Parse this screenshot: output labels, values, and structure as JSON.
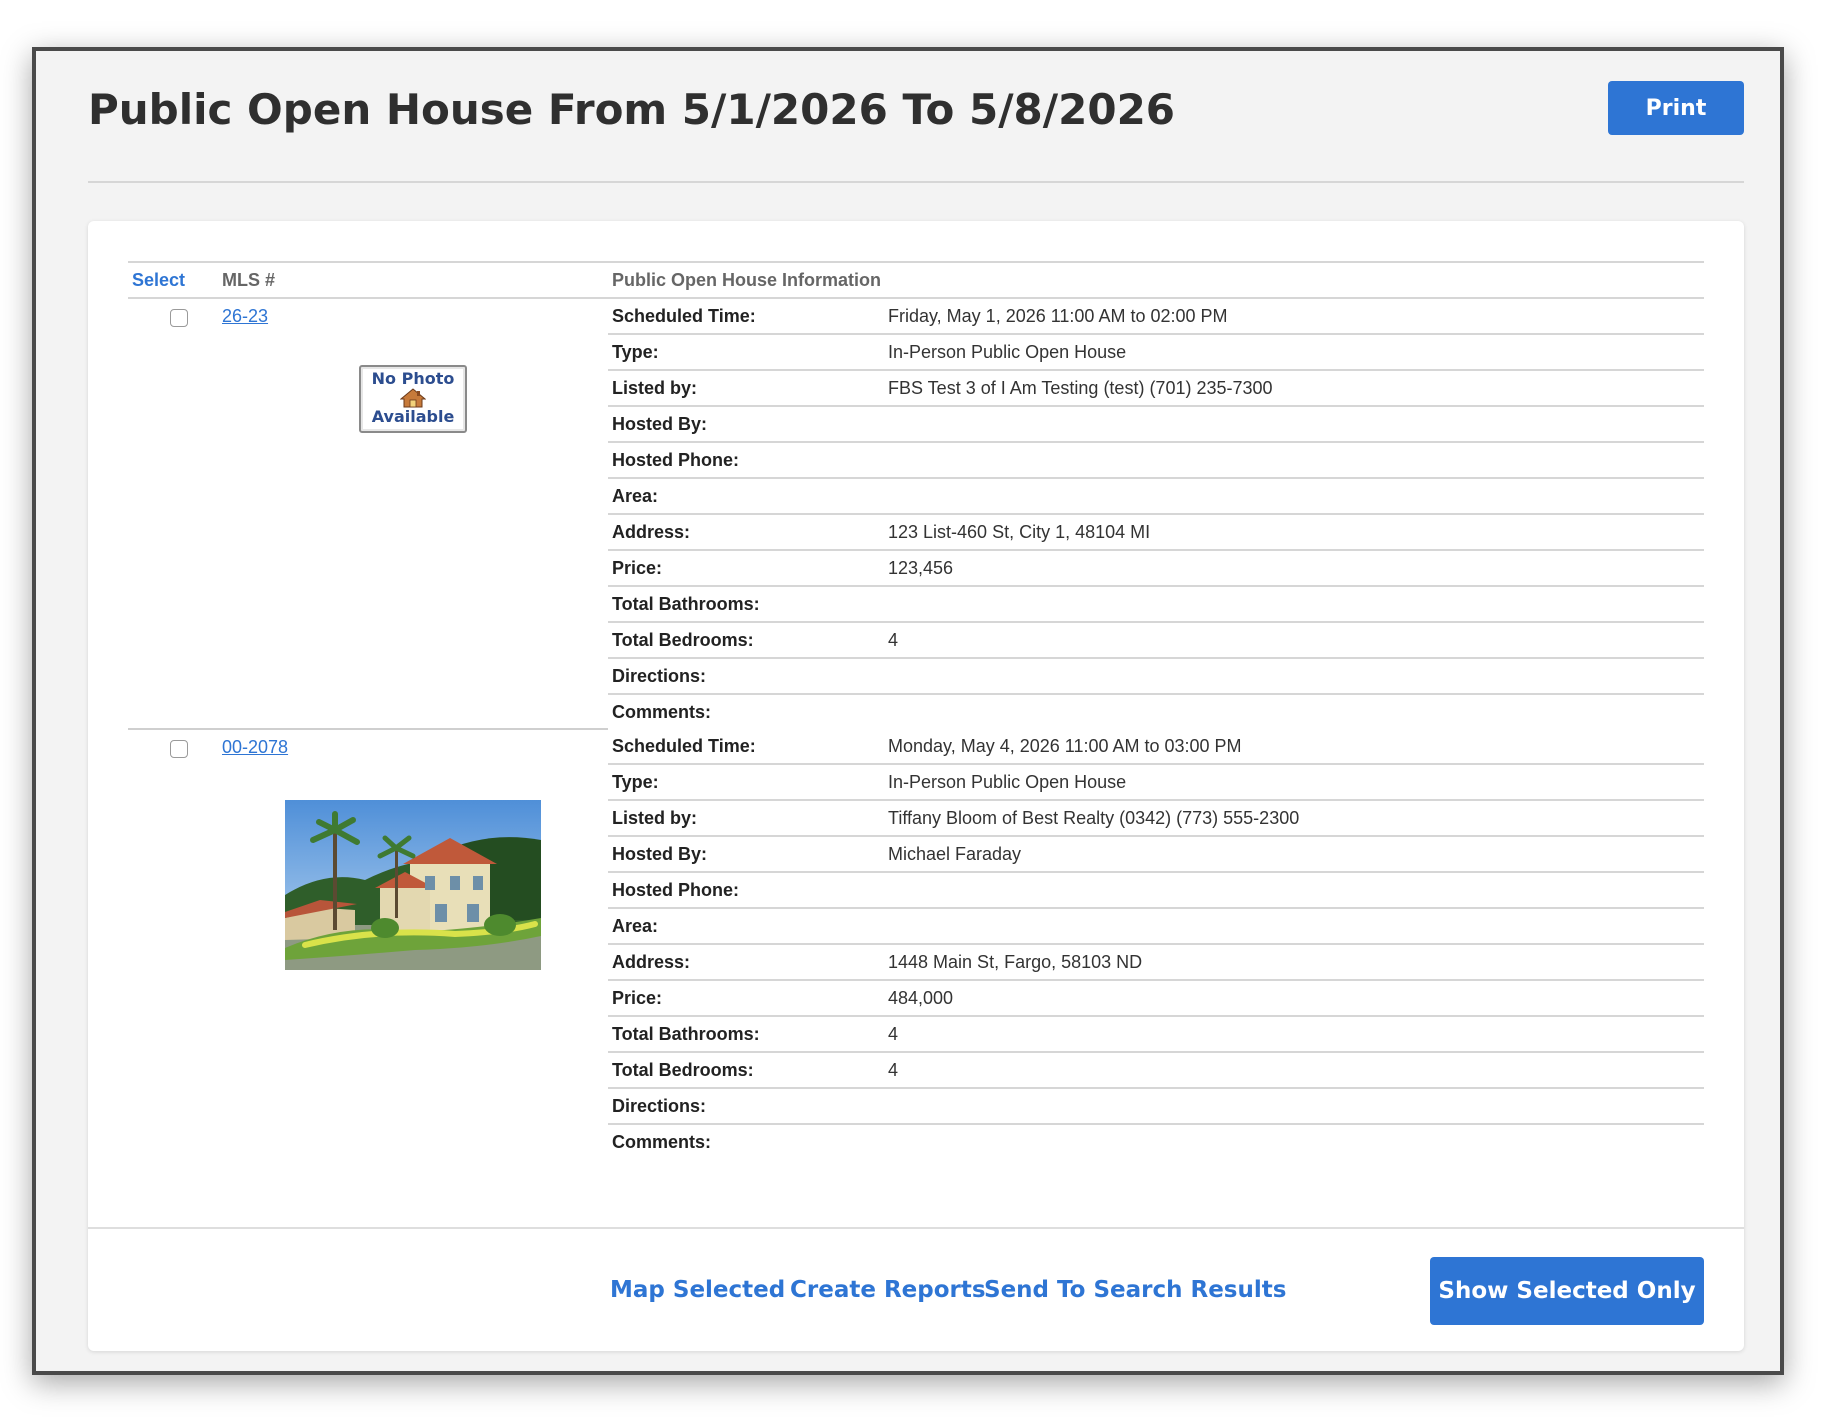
{
  "header": {
    "title": "Public Open House From 5/1/2026 To 5/8/2026",
    "print_label": "Print"
  },
  "table": {
    "headers": {
      "select": "Select",
      "mls": "MLS #",
      "info": "Public Open House Information"
    },
    "listings": [
      {
        "mls": "26-23",
        "photo": "no-photo",
        "no_photo_text": [
          "No Photo",
          "Available"
        ],
        "fields": [
          {
            "label": "Scheduled Time:",
            "value": "Friday, May 1, 2026 11:00 AM to 02:00 PM"
          },
          {
            "label": "Type:",
            "value": "In-Person Public Open House"
          },
          {
            "label": "Listed by:",
            "value": "FBS Test 3 of I Am Testing (test) (701) 235-7300"
          },
          {
            "label": "Hosted By:",
            "value": ""
          },
          {
            "label": "Hosted Phone:",
            "value": ""
          },
          {
            "label": "Area:",
            "value": ""
          },
          {
            "label": "Address:",
            "value": "123 List-460 St, City 1, 48104 MI"
          },
          {
            "label": "Price:",
            "value": "123,456"
          },
          {
            "label": "Total Bathrooms:",
            "value": ""
          },
          {
            "label": "Total Bedrooms:",
            "value": "4"
          },
          {
            "label": "Directions:",
            "value": ""
          },
          {
            "label": "Comments:",
            "value": ""
          }
        ]
      },
      {
        "mls": "00-2078",
        "photo": "house-photo",
        "fields": [
          {
            "label": "Scheduled Time:",
            "value": "Monday, May 4, 2026 11:00 AM to 03:00 PM"
          },
          {
            "label": "Type:",
            "value": "In-Person Public Open House"
          },
          {
            "label": "Listed by:",
            "value": "Tiffany Bloom of Best Realty (0342) (773) 555-2300"
          },
          {
            "label": "Hosted By:",
            "value": "Michael Faraday"
          },
          {
            "label": "Hosted Phone:",
            "value": ""
          },
          {
            "label": "Area:",
            "value": ""
          },
          {
            "label": "Address:",
            "value": "1448 Main St, Fargo, 58103 ND"
          },
          {
            "label": "Price:",
            "value": "484,000"
          },
          {
            "label": "Total Bathrooms:",
            "value": "4"
          },
          {
            "label": "Total Bedrooms:",
            "value": "4"
          },
          {
            "label": "Directions:",
            "value": ""
          },
          {
            "label": "Comments:",
            "value": ""
          }
        ]
      }
    ]
  },
  "actions": {
    "map_selected": "Map Selected",
    "create_reports": "Create Reports",
    "send_to_search_results": "Send To Search Results",
    "show_selected_only": "Show Selected Only"
  },
  "colors": {
    "accent": "#2e75d4",
    "title_text": "#2f2f2f",
    "panel_bg": "#f3f3f3"
  }
}
